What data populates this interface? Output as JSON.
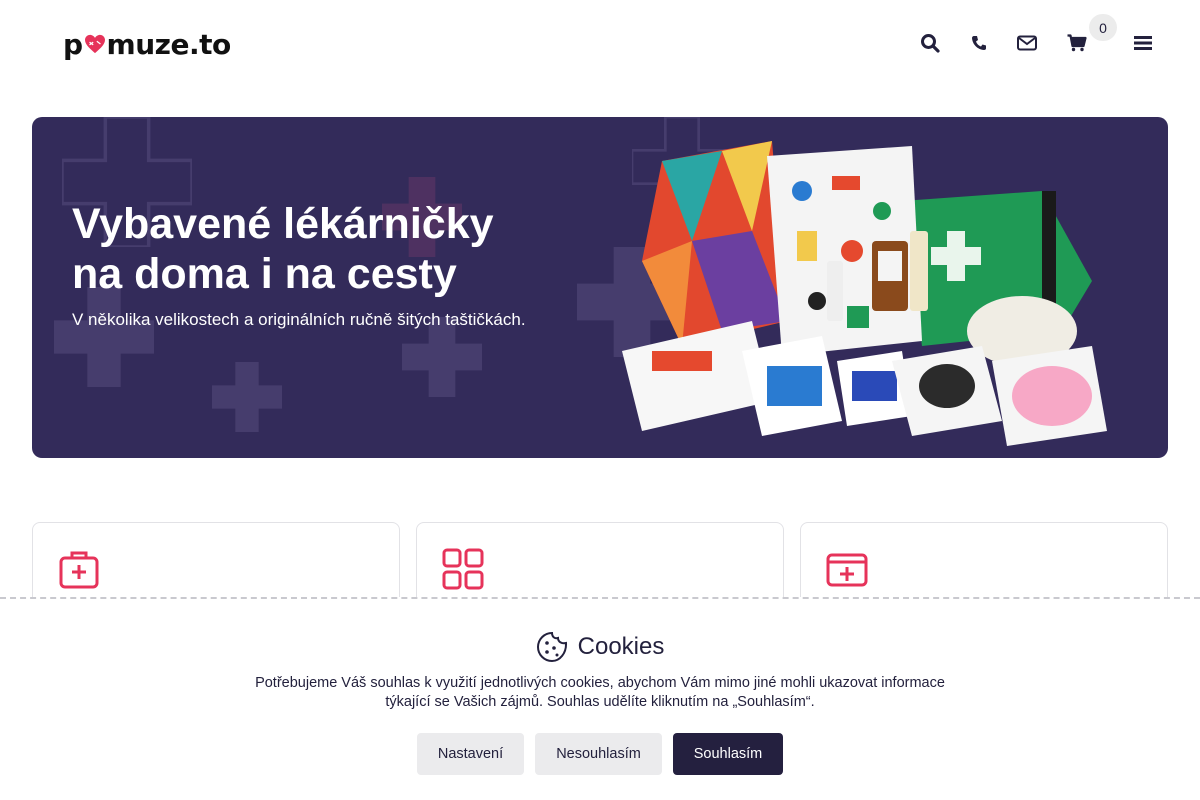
{
  "header": {
    "logo_text_1": "p",
    "logo_text_2": "muze.to",
    "icons": [
      "search-icon",
      "phone-icon",
      "envelope-icon",
      "cart-icon",
      "menu-icon"
    ],
    "cart_count": "0"
  },
  "hero": {
    "title_line1": "Vybavené lékárničky",
    "title_line2": "na doma i na cesty",
    "subtitle": "V několika velikostech a originálních ručně šitých taštičkách.",
    "background": "#332b5a"
  },
  "cards": [
    {
      "icon": "medical-bag-icon"
    },
    {
      "icon": "grid-icon"
    },
    {
      "icon": "first-aid-card-icon"
    }
  ],
  "cookies": {
    "title": "Cookies",
    "text_line1": "Potřebujeme Váš souhlas k využití jednotlivých cookies, abychom Vám mimo jiné mohli ukazovat informace",
    "text_line2": "týkající se Vašich zájmů. Souhlas udělíte kliknutím na „Souhlasím“.",
    "settings_label": "Nastavení",
    "reject_label": "Nesouhlasím",
    "accept_label": "Souhlasím"
  },
  "colors": {
    "accent": "#e6335a",
    "dark": "#24203f",
    "hero": "#332b5a"
  }
}
